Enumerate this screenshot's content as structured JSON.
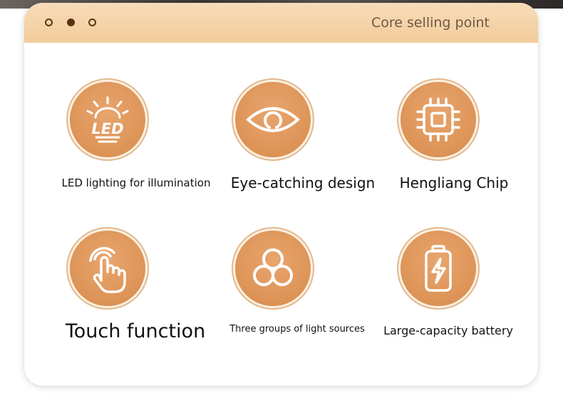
{
  "header": {
    "title": "Core selling point"
  },
  "features": [
    {
      "icon": "led-icon",
      "label": "LED lighting for illumination"
    },
    {
      "icon": "eye-icon",
      "label": "Eye-catching design"
    },
    {
      "icon": "chip-icon",
      "label": "Hengliang Chip"
    },
    {
      "icon": "touch-hand-icon",
      "label": "Touch function"
    },
    {
      "icon": "light-sources-icon",
      "label": "Three groups of light sources"
    },
    {
      "icon": "battery-icon",
      "label": "Large-capacity battery"
    }
  ],
  "led_icon_text": "LED",
  "colors": {
    "header_gradient_start": "#f7dcb8",
    "header_gradient_end": "#f2cc9c",
    "icon_fill": "#dd9356",
    "icon_ring": "#e2b98d",
    "dot_color": "#5a3410",
    "title_color": "#6e5744"
  }
}
